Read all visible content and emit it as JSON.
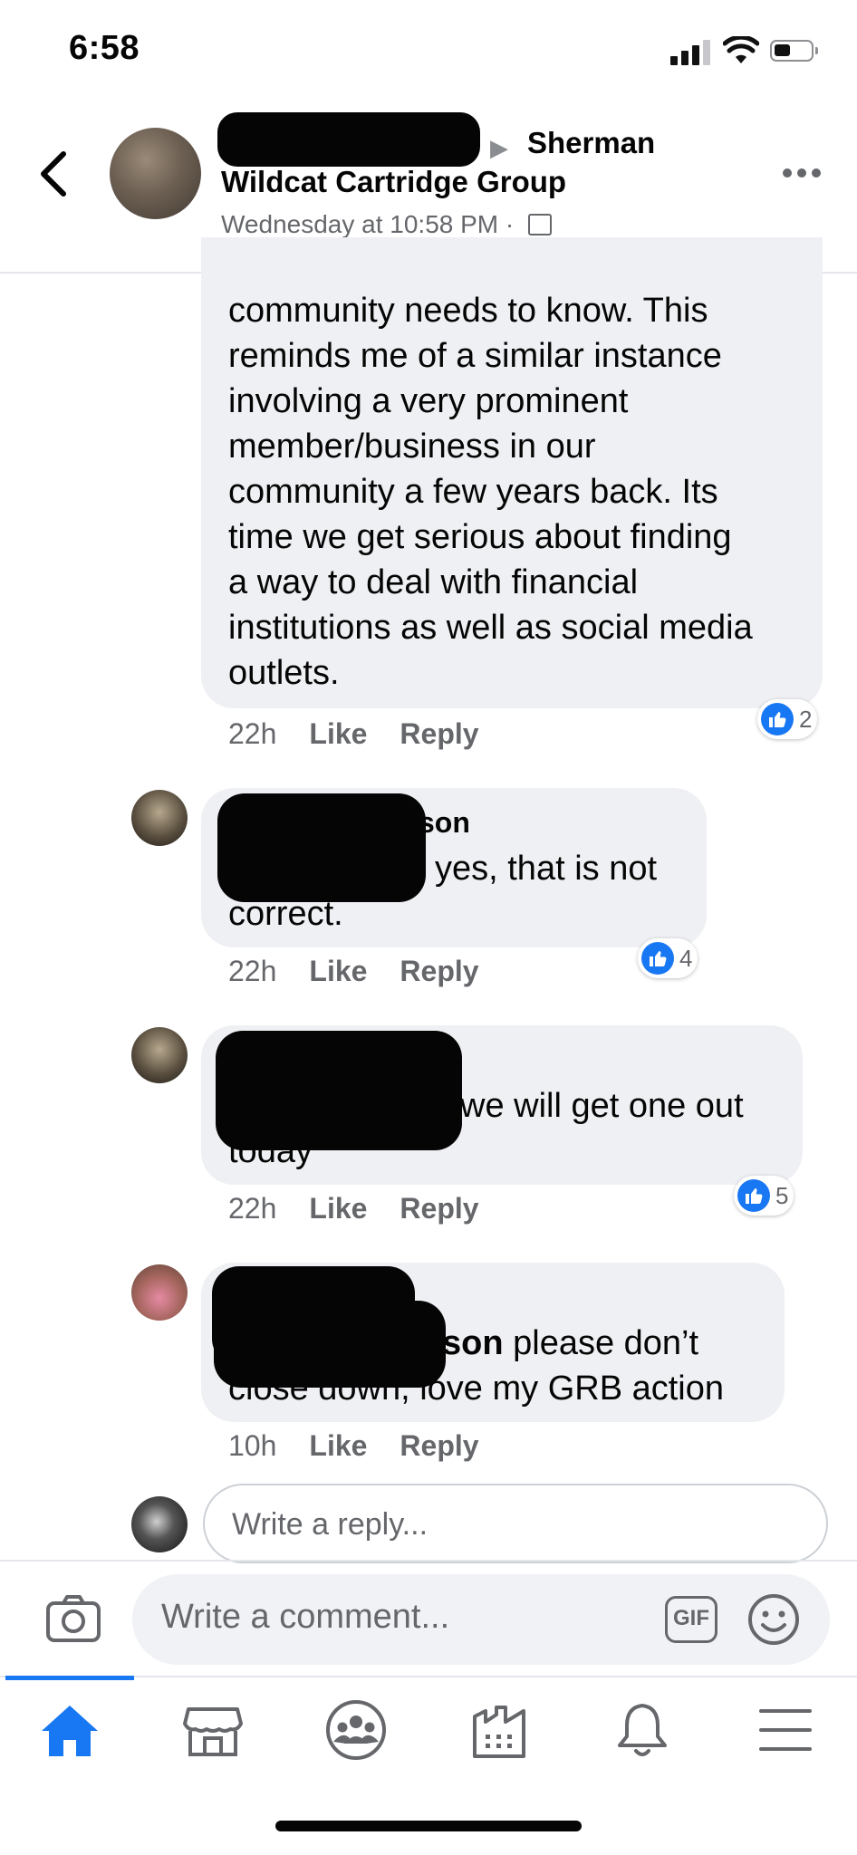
{
  "status_bar": {
    "time": "6:58"
  },
  "header": {
    "group_title_line1": "Sherman",
    "group_title_line2": "Wildcat Cartridge Group",
    "timestamp": "Wednesday at 10:58 PM ·"
  },
  "comments": [
    {
      "text_lines": [
        "community needs to know. This",
        "reminds me of a similar instance",
        "involving a very prominent",
        "member/business in our",
        "community a few years back. Its",
        "time we get serious about finding",
        "a way to deal with financial",
        "institutions as well as social media",
        "outlets."
      ],
      "time": "22h",
      "like_label": "Like",
      "reply_label": "Reply",
      "reactions": "2"
    },
    {
      "author_visible": "son",
      "text_line1": "yes, that is not",
      "text_line2": "correct.",
      "time": "22h",
      "like_label": "Like",
      "reply_label": "Reply",
      "reactions": "4"
    },
    {
      "text_line1": "we will get one out",
      "text_line2": "today",
      "time": "22h",
      "like_label": "Like",
      "reply_label": "Reply",
      "reactions": "5"
    },
    {
      "mention_visible": "son",
      "text_line1": "please don’t",
      "text_line2": "close down, love my GRB action",
      "time": "10h",
      "like_label": "Like",
      "reply_label": "Reply"
    }
  ],
  "reply_box": {
    "placeholder": "Write a reply..."
  },
  "composer": {
    "placeholder": "Write a comment...",
    "gif_label": "GIF"
  },
  "tabs": [
    "home-icon",
    "marketplace-icon",
    "groups-icon",
    "pages-icon",
    "notifications-icon",
    "menu-icon"
  ],
  "colors": {
    "accent": "#1877f2",
    "bubble": "#eff0f3",
    "secondary_text": "#65676b"
  }
}
